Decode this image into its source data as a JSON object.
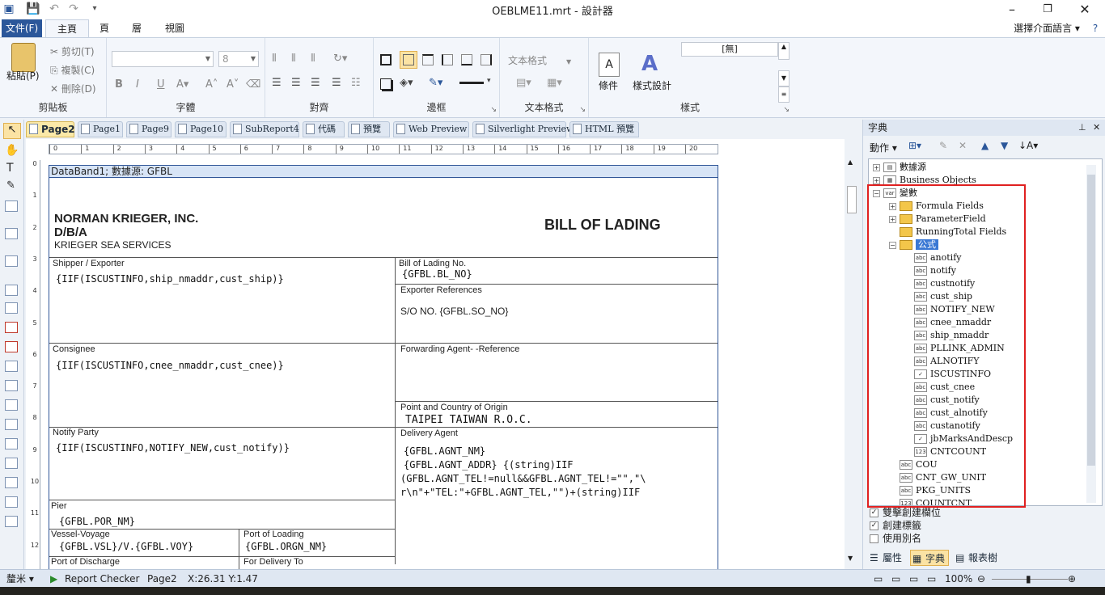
{
  "window": {
    "title": "OEBLME11.mrt - 設計器",
    "quick_access": [
      "save-icon",
      "undo-icon",
      "redo-icon",
      "customize-icon"
    ],
    "language_selector": "選擇介面語言"
  },
  "ribbon": {
    "file_tab": "文件(F)",
    "tabs": [
      "主頁",
      "頁",
      "層",
      "視圖"
    ],
    "clipboard": {
      "label": "剪貼板",
      "paste": "粘貼(P)",
      "cut": "剪切(T)",
      "copy": "複製(C)",
      "delete": "刪除(D)"
    },
    "font": {
      "label": "字體",
      "size_value": "8"
    },
    "alignment": {
      "label": "對齊"
    },
    "borders": {
      "label": "邊框"
    },
    "text_format": {
      "label": "文本格式",
      "combo": "文本格式"
    },
    "style": {
      "label": "樣式",
      "condition": "條件",
      "style_designer": "樣式設計",
      "style_value": "[無]"
    }
  },
  "doc_tabs": [
    "Page2",
    "Page1",
    "Page9",
    "Page10",
    "SubReport4",
    "代碼",
    "預覽",
    "Web Preview",
    "Silverlight Preview",
    "HTML 預覽"
  ],
  "ruler": {
    "h_ticks": [
      "0",
      "1",
      "2",
      "3",
      "4",
      "5",
      "6",
      "7",
      "8",
      "9",
      "10",
      "11",
      "12",
      "13",
      "14",
      "15",
      "16",
      "17",
      "18",
      "19",
      "20"
    ],
    "v_ticks": [
      "0",
      "1",
      "2",
      "3",
      "4",
      "5",
      "6",
      "7",
      "8",
      "9",
      "10",
      "11",
      "12"
    ]
  },
  "report": {
    "band_header": "DataBand1; 數據源: GFBL",
    "company_name": "NORMAN KRIEGER, INC.",
    "dba": "D/B/A",
    "company_sub": "KRIEGER SEA SERVICES",
    "doc_title": "BILL OF LADING",
    "shipper_label": "Shipper / Exporter",
    "shipper_expr": "{IIF(ISCUSTINFO,ship_nmaddr,cust_ship)}",
    "bl_no_label": "Bill of Lading No.",
    "bl_no_expr": "{GFBL.BL_NO}",
    "exporter_ref_label": "Exporter References",
    "exporter_ref_expr": "S/O NO. {GFBL.SO_NO}",
    "consignee_label": "Consignee",
    "consignee_expr": "{IIF(ISCUSTINFO,cnee_nmaddr,cust_cnee)}",
    "forwarding_label": "Forwarding Agent- -Reference",
    "origin_label": "Point and Country of Origin",
    "origin_expr": "TAIPEI TAIWAN R.O.C.",
    "notify_label": "Notify Party",
    "notify_expr": "{IIF(ISCUSTINFO,NOTIFY_NEW,cust_notify)}",
    "delivery_label": "Delivery Agent",
    "delivery_expr_1": "{GFBL.AGNT_NM}",
    "delivery_expr_2": "{GFBL.AGNT_ADDR} {(string)IIF",
    "delivery_expr_3": "(GFBL.AGNT_TEL!=null&&GFBL.AGNT_TEL!=\"\",\"\\",
    "delivery_expr_4": "r\\n\"+\"TEL:\"+GFBL.AGNT_TEL,\"\")+(string)IIF",
    "pier_label": "Pier",
    "pier_expr": "{GFBL.POR_NM}",
    "vessel_label": "Vessel-Voyage",
    "vessel_expr": "{GFBL.VSL}/V.{GFBL.VOY}",
    "loading_label": "Port of Loading",
    "loading_expr": "{GFBL.ORGN_NM}",
    "discharge_label": "Port of Discharge",
    "for_delivery_label": "For Delivery To"
  },
  "dictionary": {
    "title": "字典",
    "actions": "動作",
    "tree": [
      {
        "label": "數據源",
        "level": 0,
        "icon": "datasource"
      },
      {
        "label": "Business Objects",
        "level": 0,
        "icon": "business"
      },
      {
        "label": "變數",
        "level": 0,
        "icon": "var"
      },
      {
        "label": "Formula Fields",
        "level": 1,
        "icon": "folder"
      },
      {
        "label": "ParameterField",
        "level": 1,
        "icon": "folder"
      },
      {
        "label": "RunningTotal Fields",
        "level": 1,
        "icon": "folder"
      },
      {
        "label": "公式",
        "level": 1,
        "icon": "folder",
        "selected": true
      },
      {
        "label": "anotify",
        "level": 2,
        "icon": "abc"
      },
      {
        "label": "notify",
        "level": 2,
        "icon": "abc"
      },
      {
        "label": "custnotify",
        "level": 2,
        "icon": "abc"
      },
      {
        "label": "cust_ship",
        "level": 2,
        "icon": "abc"
      },
      {
        "label": "NOTIFY_NEW",
        "level": 2,
        "icon": "abc"
      },
      {
        "label": "cnee_nmaddr",
        "level": 2,
        "icon": "abc"
      },
      {
        "label": "ship_nmaddr",
        "level": 2,
        "icon": "abc"
      },
      {
        "label": "PLLINK_ADMIN",
        "level": 2,
        "icon": "abc"
      },
      {
        "label": "ALNOTIFY",
        "level": 2,
        "icon": "abc"
      },
      {
        "label": "ISCUSTINFO",
        "level": 2,
        "icon": "bool"
      },
      {
        "label": "cust_cnee",
        "level": 2,
        "icon": "abc"
      },
      {
        "label": "cust_notify",
        "level": 2,
        "icon": "abc"
      },
      {
        "label": "cust_alnotify",
        "level": 2,
        "icon": "abc"
      },
      {
        "label": "custanotify",
        "level": 2,
        "icon": "abc"
      },
      {
        "label": "jbMarksAndDescp",
        "level": 2,
        "icon": "bool"
      },
      {
        "label": "CNTCOUNT",
        "level": 2,
        "icon": "num"
      },
      {
        "label": "COU",
        "level": 1,
        "icon": "abc"
      },
      {
        "label": "CNT_GW_UNIT",
        "level": 1,
        "icon": "abc"
      },
      {
        "label": "PKG_UNITS",
        "level": 1,
        "icon": "abc"
      },
      {
        "label": "COUNTCNT",
        "level": 1,
        "icon": "num"
      }
    ],
    "options": [
      {
        "label": "雙擊創建欄位",
        "checked": true
      },
      {
        "label": "創建標籤",
        "checked": true
      },
      {
        "label": "使用別名",
        "checked": false
      }
    ],
    "panel_tabs": [
      "屬性",
      "字典",
      "報表樹"
    ]
  },
  "status": {
    "unit": "釐米",
    "report_checker": "Report Checker",
    "page": "Page2",
    "coords": "X:26.31  Y:1.47",
    "zoom": "100%"
  }
}
